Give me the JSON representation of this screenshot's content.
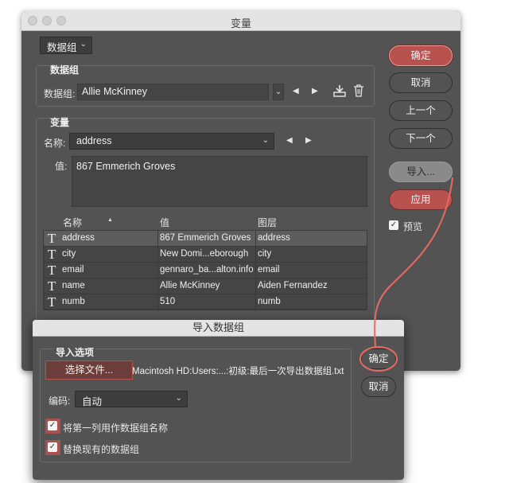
{
  "window": {
    "title": "变量"
  },
  "top_select": {
    "value": "数据组"
  },
  "dataset_group": {
    "heading": "数据组",
    "label": "数据组:",
    "value": "Allie McKinney"
  },
  "variables_group": {
    "heading": "变量",
    "name_label": "名称:",
    "name_value": "address",
    "value_label": "值:",
    "value_text": "867 Emmerich Groves"
  },
  "table": {
    "headers": [
      "名称",
      "值",
      "图层"
    ],
    "rows": [
      {
        "name": "address",
        "value": "867 Emmerich Groves",
        "layer": "address"
      },
      {
        "name": "city",
        "value": "New Domi...eborough",
        "layer": "city"
      },
      {
        "name": "email",
        "value": "gennaro_ba...alton.info",
        "layer": "email"
      },
      {
        "name": "name",
        "value": "Allie McKinney",
        "layer": "Aiden Fernandez"
      },
      {
        "name": "numb",
        "value": "510",
        "layer": "numb"
      }
    ]
  },
  "right_buttons": {
    "ok": "确定",
    "cancel": "取消",
    "prev": "上一个",
    "next": "下一个",
    "import": "导入...",
    "apply": "应用",
    "preview": "预览"
  },
  "import_dialog": {
    "title": "导入数据组",
    "options_heading": "导入选项",
    "choose_file": "选择文件...",
    "file_path": "Macintosh HD:Users:...:初级:最后一次导出数据组.txt",
    "encoding_label": "编码:",
    "encoding_value": "自动",
    "check_first_column": "将第一列用作数据组名称",
    "check_replace": "替换现有的数据组",
    "ok": "确定",
    "cancel": "取消"
  },
  "colors": {
    "accent": "#b7524f",
    "panel": "#535353",
    "field": "#454545",
    "annotation": "#e56b63"
  }
}
